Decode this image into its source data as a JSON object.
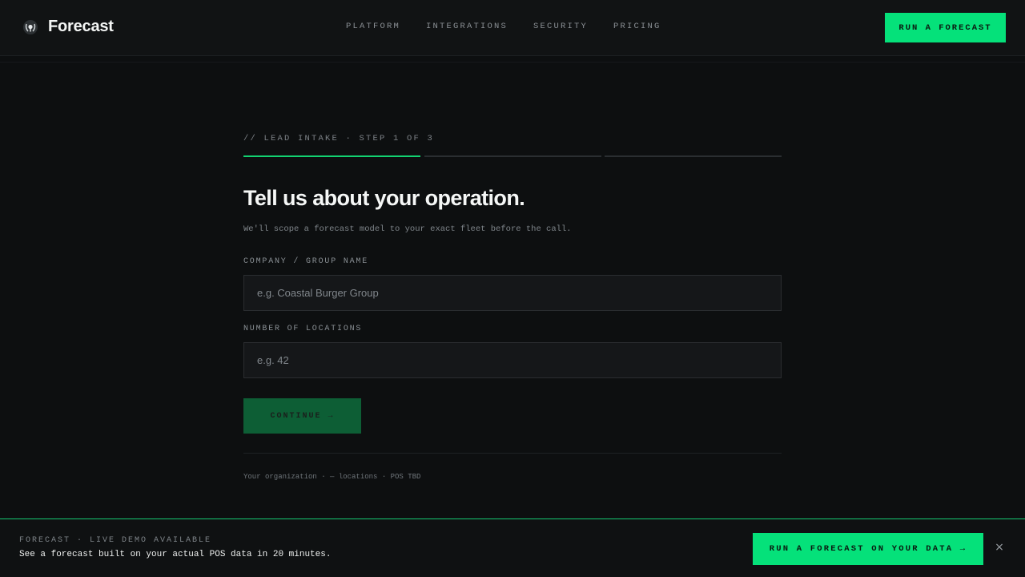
{
  "brand": {
    "name": "Forecast",
    "logo_icon": "wreath-logo-icon"
  },
  "nav": {
    "items": [
      {
        "label": "PLATFORM"
      },
      {
        "label": "INTEGRATIONS"
      },
      {
        "label": "SECURITY"
      },
      {
        "label": "PRICING"
      }
    ],
    "cta_label": "RUN A FORECAST"
  },
  "form": {
    "step_label": "// LEAD INTAKE · STEP 1 OF 3",
    "progress": {
      "current_step": 1,
      "total_steps": 3
    },
    "title": "Tell us about your operation.",
    "subtitle": "We'll scope a forecast model to your exact fleet before the call.",
    "company_field": {
      "label": "COMPANY / GROUP NAME",
      "value": "",
      "placeholder": "e.g. Coastal Burger Group"
    },
    "locations_field": {
      "label": "NUMBER OF LOCATIONS",
      "value": "",
      "placeholder": "e.g. 42"
    },
    "continue_label": "CONTINUE →",
    "summary": "Your organization · — locations · POS TBD"
  },
  "banner": {
    "kicker": "FORECAST · LIVE DEMO AVAILABLE",
    "text": "See a forecast built on your actual POS data in 20 minutes.",
    "cta_label": "RUN A FORECAST ON YOUR DATA →",
    "close_label": "×"
  },
  "colors": {
    "accent": "#05e17a",
    "background": "#0d0f10",
    "continue_disabled": "#0d5e35"
  }
}
